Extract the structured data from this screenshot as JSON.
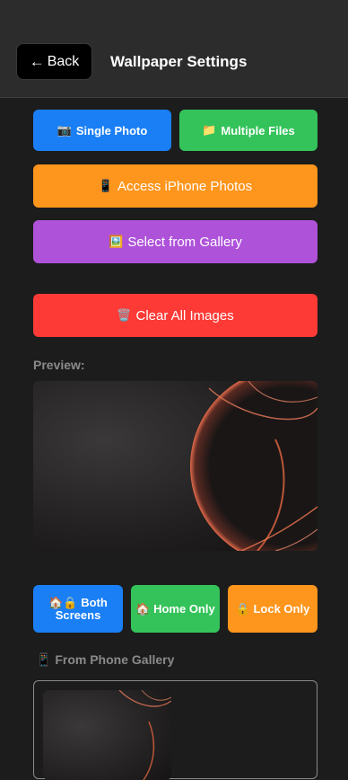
{
  "header": {
    "back_label": "Back",
    "back_icon": "←",
    "title": "Wallpaper Settings"
  },
  "source_buttons": {
    "single_photo": {
      "icon": "📷",
      "label": "Single Photo",
      "color": "#1a7ff5"
    },
    "multiple_files": {
      "icon": "📁",
      "label": "Multiple Files",
      "color": "#34c35a"
    },
    "iphone_photos": {
      "icon": "📱",
      "label": "Access iPhone Photos",
      "color": "#fe951c"
    },
    "gallery": {
      "icon": "🖼️",
      "label": "Select from Gallery",
      "color": "#ae52da"
    }
  },
  "clear_button": {
    "icon": "🗑️",
    "label": "Clear All Images",
    "color": "#fd3a35"
  },
  "preview": {
    "label": "Preview:"
  },
  "target_buttons": {
    "both": {
      "icon": "🏠🔒",
      "label": "Both Screens",
      "color": "#1a7ff5"
    },
    "home": {
      "icon": "🏠",
      "label": "Home Only",
      "color": "#34c35a"
    },
    "lock": {
      "icon": "🔒",
      "label": "Lock Only",
      "color": "#fe951c"
    }
  },
  "phone_gallery": {
    "icon": "📱",
    "label": "From Phone Gallery"
  }
}
